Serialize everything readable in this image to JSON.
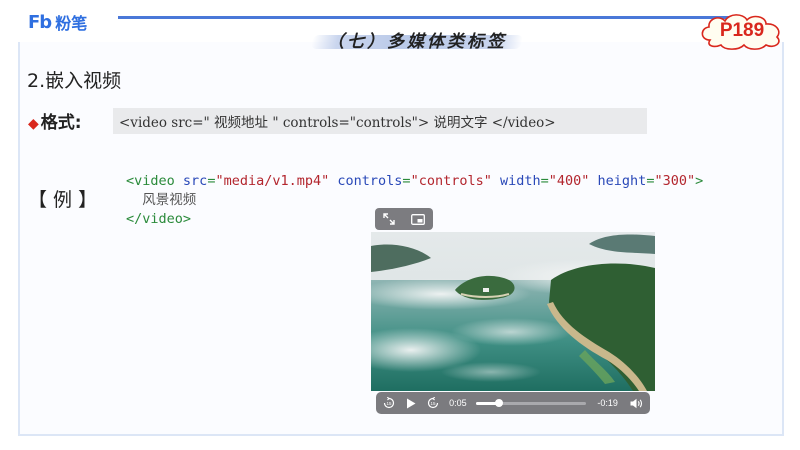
{
  "brand": {
    "logo_mark": "Fb",
    "logo_text": "粉笔"
  },
  "header": {
    "title": "（七）多媒体类标签",
    "page_label": "P189"
  },
  "content": {
    "section_heading": "2.嵌入视频",
    "format_label": "格式",
    "format_colon": ":",
    "format_syntax": "<video src=\" 视频地址 \" controls=\"controls\"> 说明文字 </video>",
    "example_label": "【 例 】",
    "code": {
      "open_tag": "<video",
      "attr_src": "src",
      "val_src": "\"media/v1.mp4\"",
      "attr_controls": "controls",
      "val_controls": "\"controls\"",
      "attr_width": "width",
      "val_width": "\"400\"",
      "attr_height": "height",
      "val_height": "\"300\"",
      "close_bracket": ">",
      "inner_text": "风景视频",
      "close_tag": "</video>",
      "eq": "="
    }
  },
  "video_player": {
    "elapsed": "0:05",
    "remaining": "-0:19",
    "progress": 0.21,
    "icons": {
      "expand": "expand-arrows-icon",
      "pip": "picture-in-picture-icon",
      "rewind": "rewind-15-icon",
      "play": "play-icon",
      "forward": "forward-15-icon",
      "volume": "volume-icon"
    }
  },
  "colors": {
    "accent_blue": "#4a78d8",
    "badge_red": "#d9271c",
    "tag_green": "#2a8a3a",
    "attr_blue": "#2a49b8",
    "value_red": "#b3262e"
  }
}
